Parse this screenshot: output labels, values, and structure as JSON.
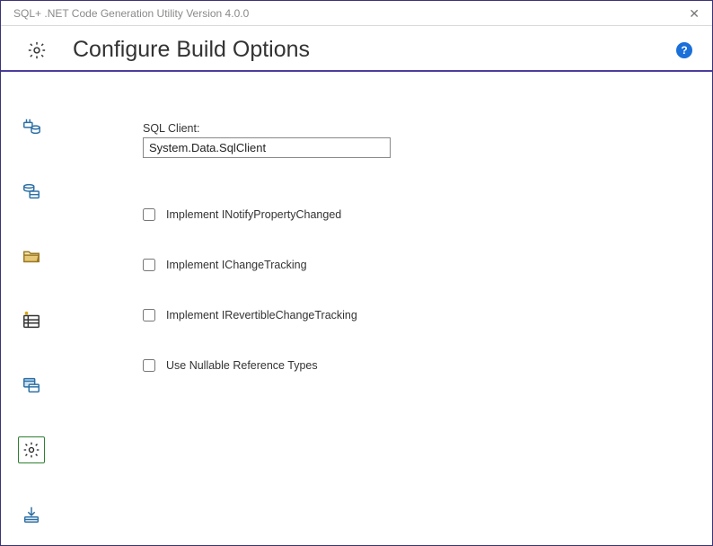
{
  "window": {
    "title": "SQL+ .NET Code Generation Utility Version 4.0.0",
    "close_label": "✕"
  },
  "header": {
    "title": "Configure Build Options",
    "help_label": "?"
  },
  "sidebar": {
    "items": [
      {
        "name": "connection",
        "selected": false
      },
      {
        "name": "database",
        "selected": false
      },
      {
        "name": "folder",
        "selected": false
      },
      {
        "name": "list",
        "selected": false
      },
      {
        "name": "window",
        "selected": false
      },
      {
        "name": "settings",
        "selected": true
      },
      {
        "name": "download",
        "selected": false
      }
    ]
  },
  "form": {
    "sql_client_label": "SQL Client:",
    "sql_client_value": "System.Data.SqlClient",
    "cb_notify": "Implement INotifyPropertyChanged",
    "cb_change": "Implement IChangeTracking",
    "cb_revert": "Implement IRevertibleChangeTracking",
    "cb_nullable": "Use Nullable Reference Types"
  }
}
